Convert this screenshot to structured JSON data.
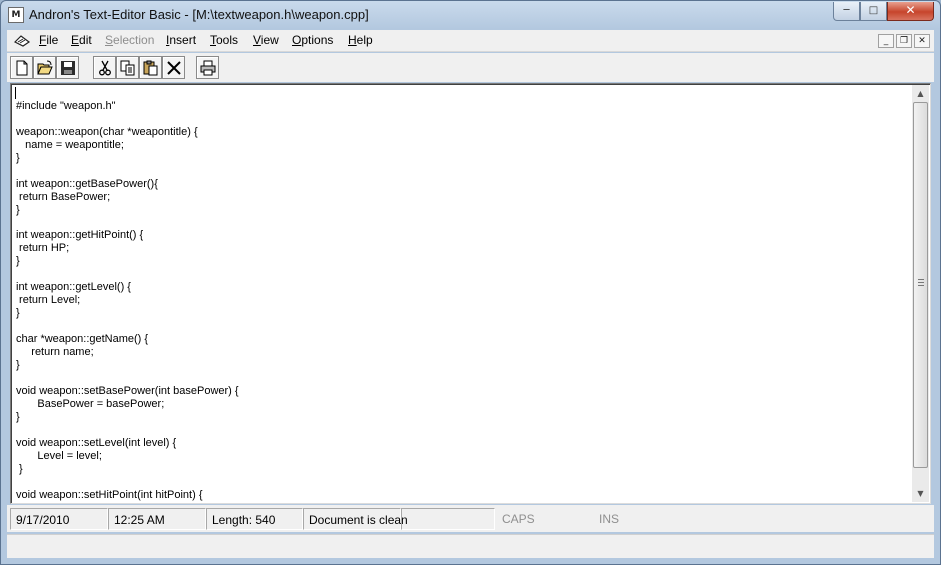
{
  "window": {
    "title": "Andron's Text-Editor Basic - [M:\\textweapon.h\\weapon.cpp]",
    "icon": "app-document-icon",
    "controls": {
      "minimize": "minimize-icon",
      "maximize": "maximize-icon",
      "close": "close-icon"
    }
  },
  "menu": {
    "items": [
      {
        "label": "File",
        "accel": "F",
        "rest": "ile",
        "enabled": true
      },
      {
        "label": "Edit",
        "accel": "E",
        "rest": "dit",
        "enabled": true
      },
      {
        "label": "Selection",
        "accel": "S",
        "rest": "election",
        "enabled": false
      },
      {
        "label": "Insert",
        "accel": "I",
        "rest": "nsert",
        "enabled": true
      },
      {
        "label": "Tools",
        "accel": "T",
        "rest": "ools",
        "enabled": true
      },
      {
        "label": "View",
        "accel": "V",
        "rest": "iew",
        "enabled": true
      },
      {
        "label": "Options",
        "accel": "O",
        "rest": "ptions",
        "enabled": true
      },
      {
        "label": "Help",
        "accel": "H",
        "rest": "elp",
        "enabled": true
      }
    ]
  },
  "toolbar": {
    "buttons": [
      "new-document-icon",
      "open-folder-icon",
      "save-disk-icon",
      "cut-scissors-icon",
      "copy-icon",
      "paste-icon",
      "delete-x-icon",
      "print-icon"
    ]
  },
  "editor": {
    "text": "\n#include \"weapon.h\"\n\nweapon::weapon(char *weapontitle) {\n   name = weapontitle;\n}\n\nint weapon::getBasePower(){\n return BasePower;\n}\n\nint weapon::getHitPoint() {\n return HP;\n}\n\nint weapon::getLevel() {\n return Level;\n}\n\nchar *weapon::getName() {\n     return name;\n}\n\nvoid weapon::setBasePower(int basePower) {\n       BasePower = basePower;\n}\n\nvoid weapon::setLevel(int level) {\n       Level = level;\n }\n\nvoid weapon::setHitPoint(int hitPoint) {"
  },
  "status": {
    "date": "9/17/2010",
    "time": "12:25 AM",
    "length": "Length: 540",
    "state": "Document is clean",
    "extra": "",
    "caps": "CAPS",
    "ins": "INS"
  }
}
